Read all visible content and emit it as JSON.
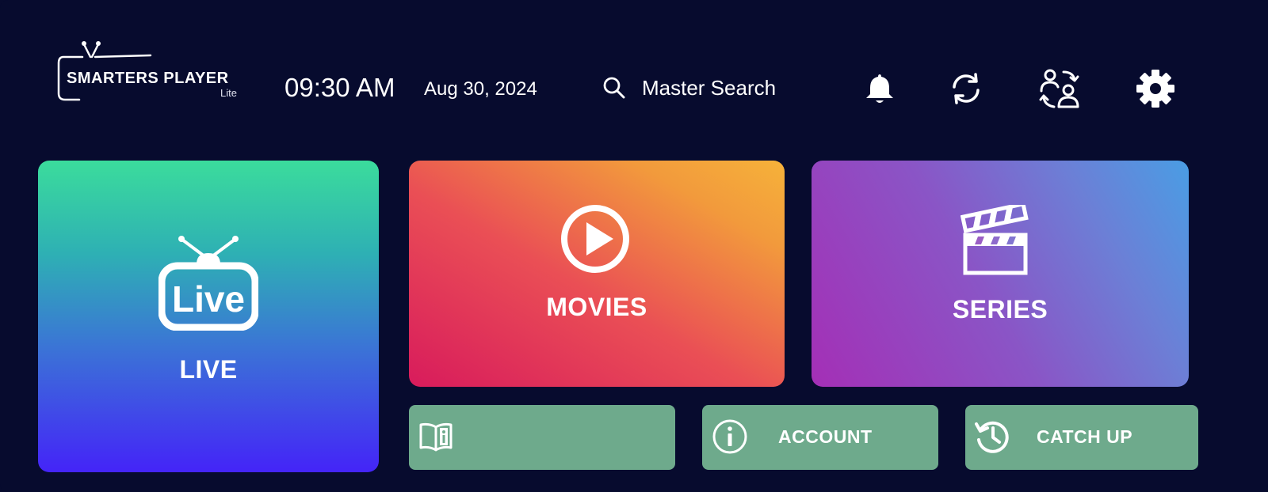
{
  "header": {
    "logo": {
      "name": "SMARTERS PLAYER",
      "sub": "Lite"
    },
    "time": "09:30 AM",
    "date": "Aug 30, 2024",
    "search_label": "Master Search",
    "icons": [
      "bell-icon",
      "sync-icon",
      "switch-user-icon",
      "gear-icon"
    ]
  },
  "tiles": {
    "live": {
      "label": "LIVE",
      "icon_text": "Live"
    },
    "movies": {
      "label": "MOVIES"
    },
    "series": {
      "label": "SERIES"
    },
    "guide": {
      "label": ""
    },
    "account": {
      "label": "ACCOUNT"
    },
    "catchup": {
      "label": "CATCH UP"
    }
  },
  "colors": {
    "background": "#070b2e",
    "small_tile": "#6eaa8c",
    "live_gradient": [
      "#3bdc9c",
      "#4424f8"
    ],
    "movies_gradient": [
      "#d81b5c",
      "#f6b23a"
    ],
    "series_gradient": [
      "#a42fb6",
      "#4a9de4"
    ]
  }
}
